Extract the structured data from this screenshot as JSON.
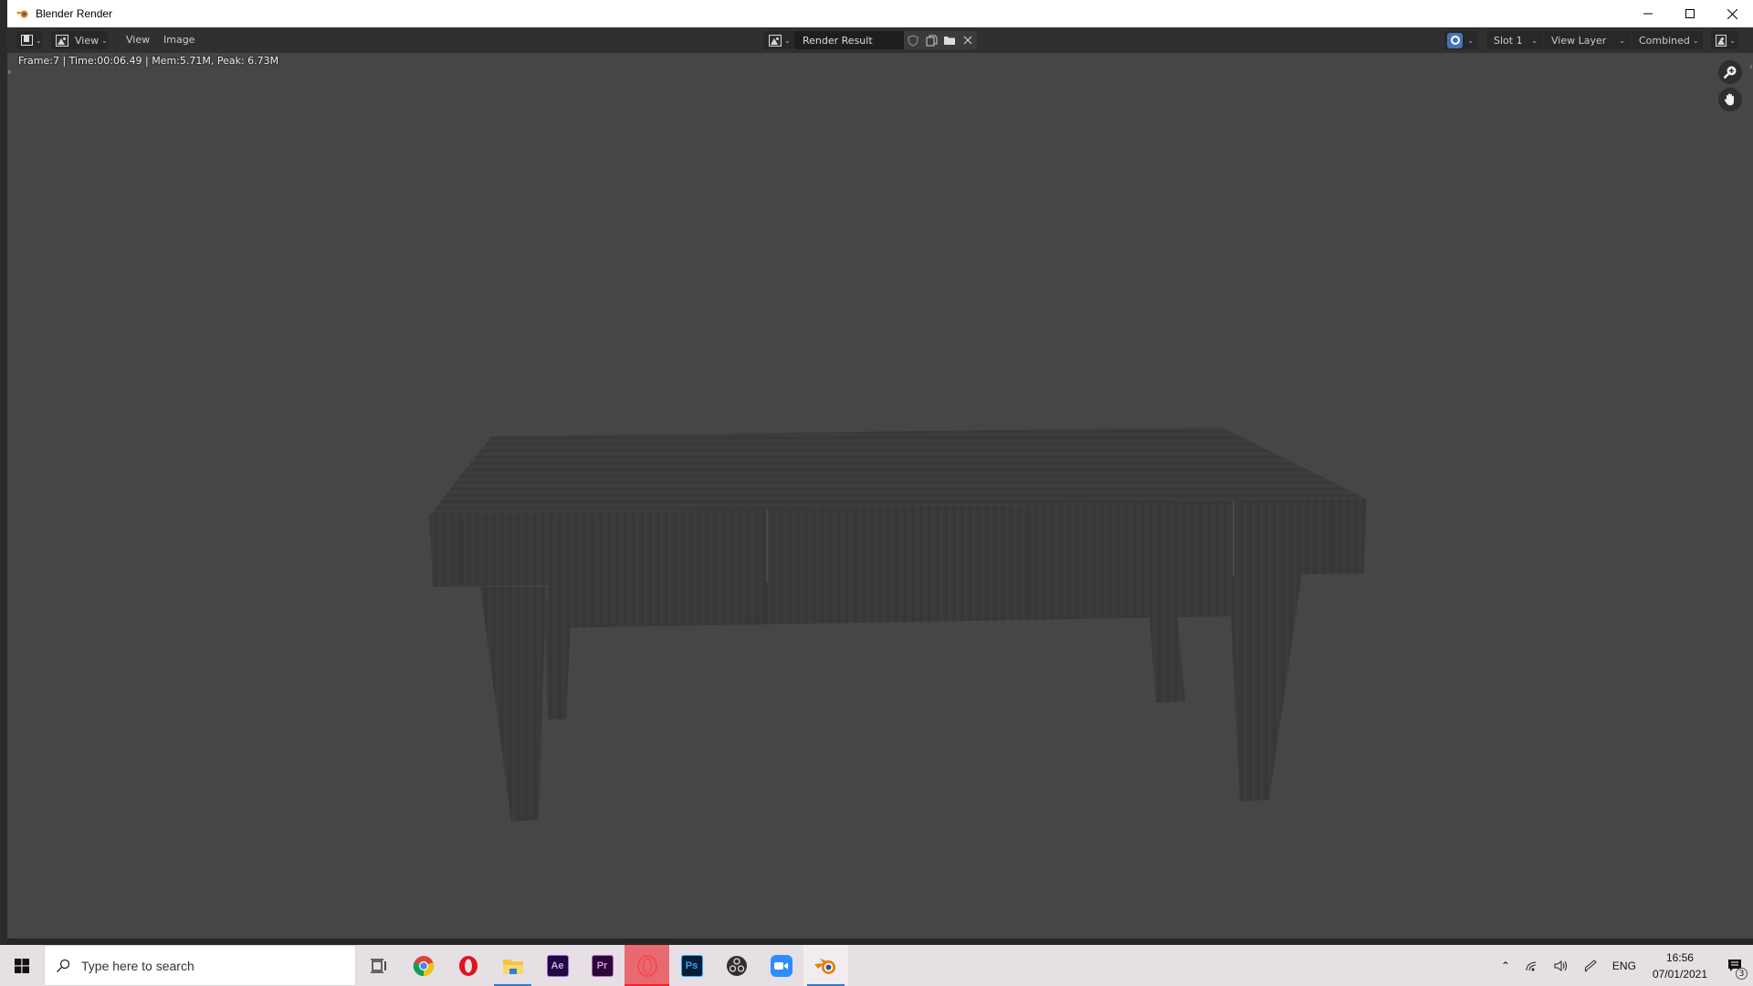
{
  "window": {
    "title": "Blender Render",
    "controls": {
      "minimize": "minimize-icon",
      "maximize": "maximize-icon",
      "close": "close-icon"
    }
  },
  "header": {
    "editor_type_icon": "image-editor-icon",
    "view_mode_label": "View",
    "menus": [
      "View",
      "Image"
    ],
    "image_browse_icon": "image-browse-icon",
    "image_name": "Render Result",
    "image_buttons": [
      "fake-user-shield-icon",
      "new-image-icon",
      "open-image-icon",
      "unlink-x-icon"
    ],
    "gizmo_toggle_icon": "gizmo-icon",
    "slot": "Slot 1",
    "view_layer": "View Layer",
    "pass": "Combined",
    "display_mode_icon": "display-channels-icon"
  },
  "viewport": {
    "render_info": "Frame:7 | Time:00:06.49 | Mem:5.71M, Peak: 6.73M",
    "nav_tools": [
      "zoom-icon",
      "pan-hand-icon"
    ],
    "background_color": "#464646",
    "render_subject": "wooden table (grayscale render)"
  },
  "taskbar": {
    "search_placeholder": "Type here to search",
    "apps": [
      {
        "name": "task-view",
        "icon": "task-view-icon"
      },
      {
        "name": "chrome",
        "icon": "chrome-icon"
      },
      {
        "name": "opera",
        "icon": "opera-icon"
      },
      {
        "name": "file-explorer",
        "icon": "folder-icon",
        "active": true
      },
      {
        "name": "after-effects",
        "icon": "ae-icon",
        "label": "Ae"
      },
      {
        "name": "premiere-pro",
        "icon": "pr-icon",
        "label": "Pr"
      },
      {
        "name": "opera-gx",
        "icon": "opera-gx-icon",
        "highlighted": true
      },
      {
        "name": "photoshop",
        "icon": "ps-icon",
        "label": "Ps"
      },
      {
        "name": "obs",
        "icon": "obs-icon"
      },
      {
        "name": "zoom",
        "icon": "zoom-camera-icon"
      },
      {
        "name": "blender",
        "icon": "blender-icon",
        "active": true
      }
    ],
    "tray": {
      "language": "ENG",
      "time": "16:56",
      "date": "07/01/2021",
      "notifications_count": "3"
    }
  },
  "colors": {
    "header_bg": "#303030",
    "viewport_bg": "#464646",
    "gizmo_accent": "#4772b3",
    "taskbar_bg": "#e6dfe3",
    "opera_gx_highlight": "#e86a70"
  }
}
